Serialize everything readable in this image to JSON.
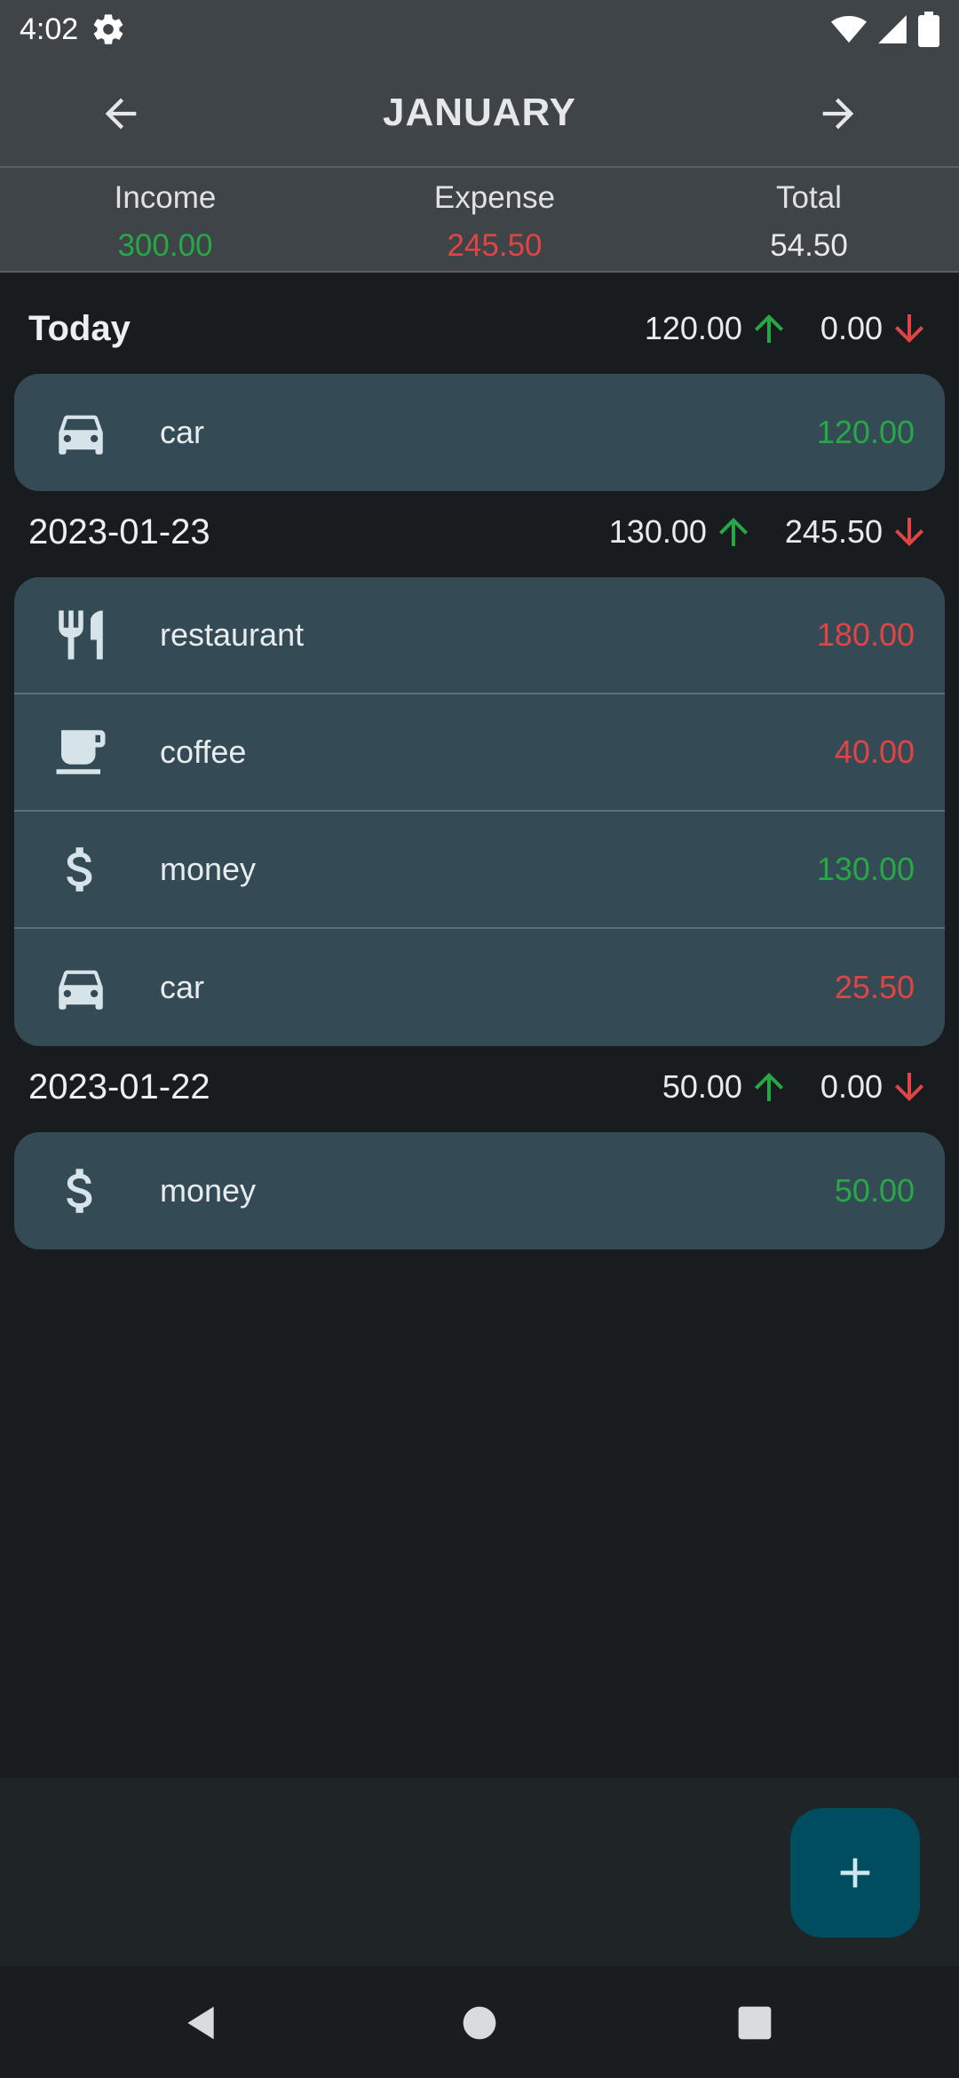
{
  "status_bar": {
    "time": "4:02"
  },
  "app_bar": {
    "title": "JANUARY"
  },
  "summary": {
    "income_label": "Income",
    "income_value": "300.00",
    "expense_label": "Expense",
    "expense_value": "245.50",
    "total_label": "Total",
    "total_value": "54.50"
  },
  "groups": [
    {
      "title": "Today",
      "income": "120.00",
      "expense": "0.00",
      "items": [
        {
          "icon": "car-icon",
          "label": "car",
          "amount": "120.00",
          "kind": "income"
        }
      ]
    },
    {
      "title": "2023-01-23",
      "income": "130.00",
      "expense": "245.50",
      "items": [
        {
          "icon": "restaurant-icon",
          "label": "restaurant",
          "amount": "180.00",
          "kind": "expense"
        },
        {
          "icon": "coffee-icon",
          "label": "coffee",
          "amount": "40.00",
          "kind": "expense"
        },
        {
          "icon": "dollar-icon",
          "label": "money",
          "amount": "130.00",
          "kind": "income"
        },
        {
          "icon": "car-icon",
          "label": "car",
          "amount": "25.50",
          "kind": "expense"
        }
      ]
    },
    {
      "title": "2023-01-22",
      "income": "50.00",
      "expense": "0.00",
      "items": [
        {
          "icon": "dollar-icon",
          "label": "money",
          "amount": "50.00",
          "kind": "income"
        }
      ]
    }
  ],
  "colors": {
    "income": "#27a847",
    "expense": "#e04444",
    "card": "#344b55",
    "fab": "#004d60"
  }
}
